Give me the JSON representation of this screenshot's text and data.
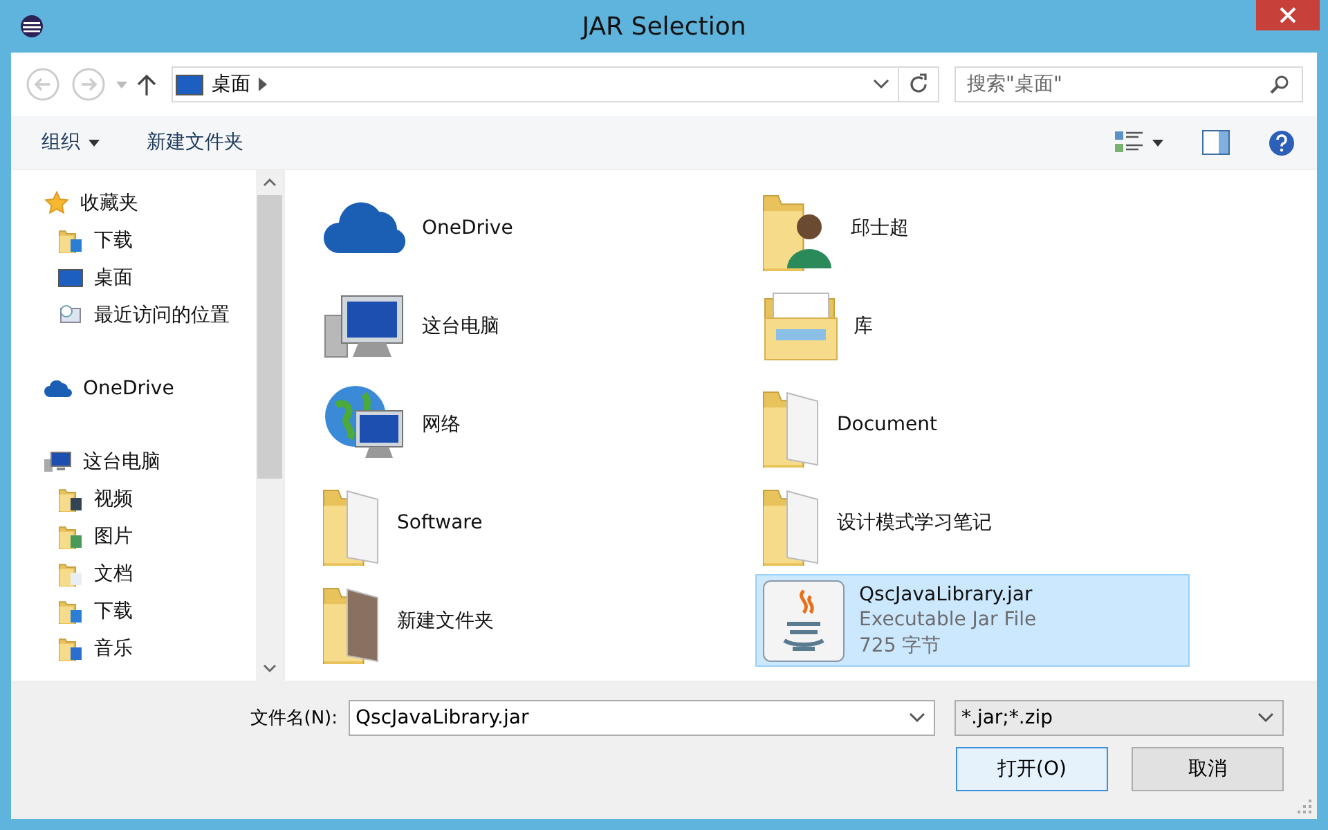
{
  "window": {
    "title": "JAR Selection"
  },
  "nav": {
    "location": "桌面",
    "search": {
      "placeholder": "搜索\"桌面\""
    }
  },
  "toolbar": {
    "buttons": [
      {
        "label": "组织",
        "kind": "menu"
      },
      {
        "label": "新建文件夹",
        "kind": "plain"
      }
    ]
  },
  "sidebar": {
    "items": [
      {
        "label": "收藏夹",
        "kind": "star",
        "children": [
          {
            "label": "下载",
            "kind": "download"
          },
          {
            "label": "桌面",
            "kind": "desktop"
          },
          {
            "label": "最近访问的位置",
            "kind": "recent"
          }
        ]
      },
      {
        "label": "OneDrive",
        "kind": "cloud"
      },
      {
        "label": "这台电脑",
        "kind": "computer",
        "children": [
          {
            "label": "视频",
            "kind": "video"
          },
          {
            "label": "图片",
            "kind": "picture"
          },
          {
            "label": "文档",
            "kind": "document"
          },
          {
            "label": "下载",
            "kind": "download"
          },
          {
            "label": "音乐",
            "kind": "music"
          }
        ]
      }
    ]
  },
  "files": [
    {
      "name": "OneDrive",
      "kind": "cloud",
      "selected": false
    },
    {
      "name": "邱士超",
      "kind": "user",
      "selected": false
    },
    {
      "name": "这台电脑",
      "kind": "computer",
      "selected": false
    },
    {
      "name": "库",
      "kind": "library",
      "selected": false
    },
    {
      "name": "网络",
      "kind": "network",
      "selected": false
    },
    {
      "name": "Document",
      "kind": "folder",
      "selected": false
    },
    {
      "name": "Software",
      "kind": "folder",
      "selected": false
    },
    {
      "name": "设计模式学习笔记",
      "kind": "folder",
      "selected": false
    },
    {
      "name": "新建文件夹",
      "kind": "photo-folder",
      "selected": false
    },
    {
      "name": "QscJavaLibrary.jar",
      "kind": "jar",
      "type": "Executable Jar File",
      "size": "725 字节",
      "selected": true
    }
  ],
  "footer": {
    "filename_label": "文件名(N):",
    "filename": "QscJavaLibrary.jar",
    "filter": "*.jar;*.zip",
    "buttons": [
      {
        "label": "打开(O)",
        "default": true
      },
      {
        "label": "取消",
        "default": false
      }
    ]
  }
}
